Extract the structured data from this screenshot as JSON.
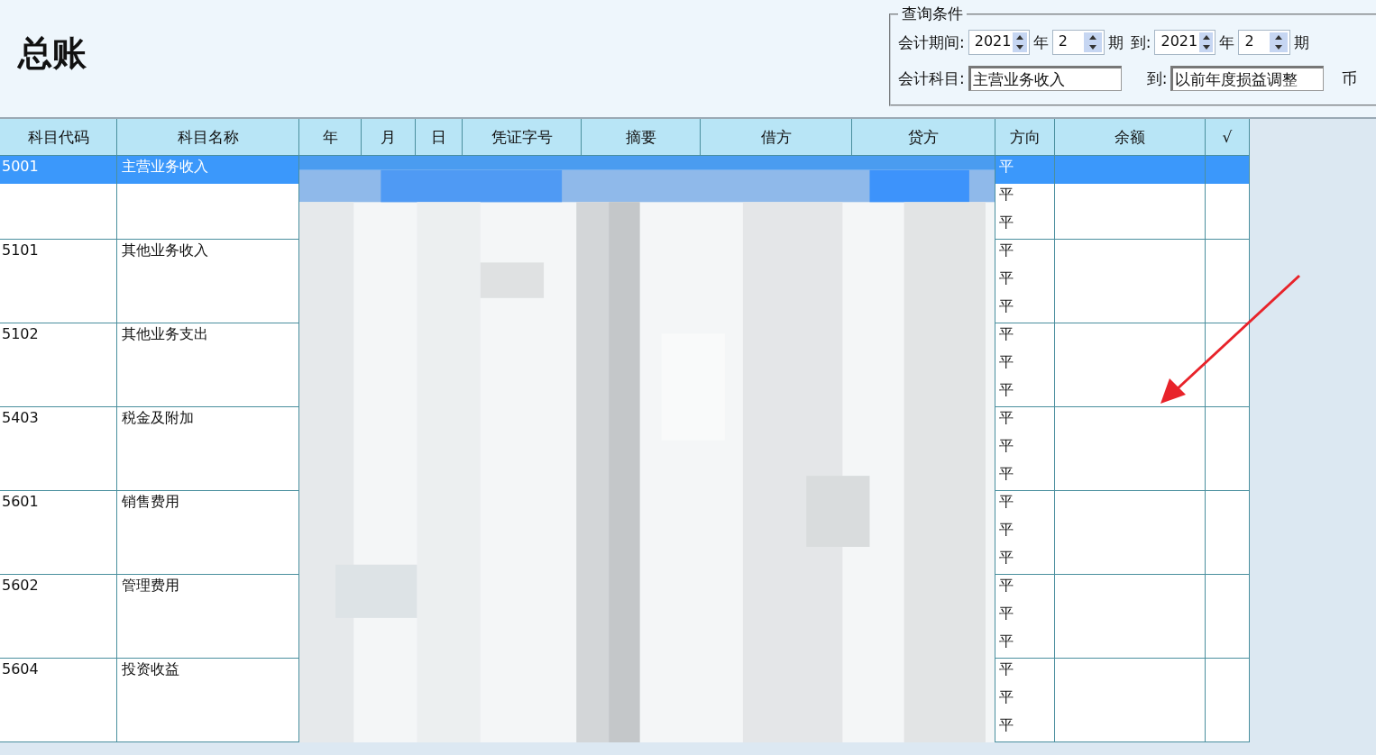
{
  "title": "总账",
  "query": {
    "title": "查询条件",
    "period": {
      "label": "会计期间:",
      "from_year": "2021",
      "year_unit": "年",
      "from_period": "2",
      "period_unit": "期",
      "to_label": "到:",
      "to_year": "2021",
      "to_year_unit": "年",
      "to_period": "2",
      "to_period_unit": "期"
    },
    "subject": {
      "label": "会计科目:",
      "from": "主营业务收入",
      "to_label": "到:",
      "to": "以前年度损益调整",
      "next_label": "币"
    }
  },
  "table": {
    "columns": [
      "科目代码",
      "科目名称",
      "年",
      "月",
      "日",
      "凭证字号",
      "摘要",
      "借方",
      "贷方",
      "方向",
      "余额",
      "√"
    ],
    "groups": [
      {
        "code": "5001",
        "name": "主营业务收入",
        "rows": [
          {
            "direction": "平",
            "selected": true
          },
          {
            "direction": "平",
            "selected": false
          },
          {
            "direction": "平",
            "selected": false
          }
        ]
      },
      {
        "code": "5101",
        "name": "其他业务收入",
        "rows": [
          {
            "direction": "平",
            "selected": false
          },
          {
            "direction": "平",
            "selected": false
          },
          {
            "direction": "平",
            "selected": false
          }
        ]
      },
      {
        "code": "5102",
        "name": "其他业务支出",
        "rows": [
          {
            "direction": "平",
            "selected": false
          },
          {
            "direction": "平",
            "selected": false
          },
          {
            "direction": "平",
            "selected": false
          }
        ]
      },
      {
        "code": "5403",
        "name": "税金及附加",
        "rows": [
          {
            "direction": "平",
            "selected": false
          },
          {
            "direction": "平",
            "selected": false
          },
          {
            "direction": "平",
            "selected": false
          }
        ]
      },
      {
        "code": "5601",
        "name": "销售费用",
        "rows": [
          {
            "direction": "平",
            "selected": false
          },
          {
            "direction": "平",
            "selected": false
          },
          {
            "direction": "平",
            "selected": false
          }
        ]
      },
      {
        "code": "5602",
        "name": "管理费用",
        "rows": [
          {
            "direction": "平",
            "selected": false
          },
          {
            "direction": "平",
            "selected": false
          },
          {
            "direction": "平",
            "selected": false
          }
        ]
      },
      {
        "code": "5604",
        "name": "投资收益",
        "rows": [
          {
            "direction": "平",
            "selected": false
          },
          {
            "direction": "平",
            "selected": false
          },
          {
            "direction": "平",
            "selected": false
          }
        ]
      }
    ]
  }
}
